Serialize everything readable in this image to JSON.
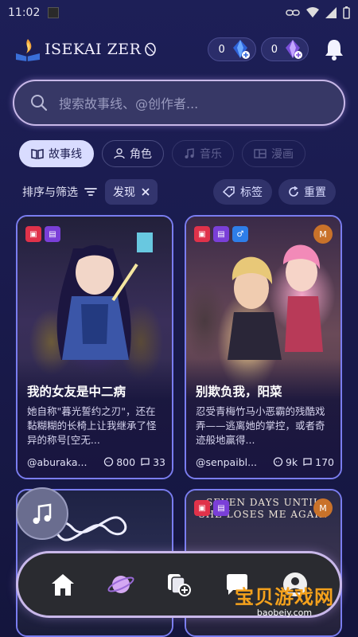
{
  "status_bar": {
    "time": "11:02"
  },
  "app": {
    "title": "ISEKAI ZER"
  },
  "currency": [
    {
      "amount": "0",
      "icon": "blue-gem-icon"
    },
    {
      "amount": "0",
      "icon": "purple-gem-icon"
    }
  ],
  "search": {
    "placeholder": "搜索故事线、@创作者..."
  },
  "chips": [
    {
      "label": "故事线",
      "icon": "book-icon",
      "active": true
    },
    {
      "label": "角色",
      "icon": "person-icon",
      "active": false
    },
    {
      "label": "音乐",
      "icon": "music-note-icon",
      "active": false
    },
    {
      "label": "漫画",
      "icon": "comic-icon",
      "active": false
    }
  ],
  "filter": {
    "sort_label": "排序与筛选",
    "active_tag": "发现",
    "tags_label": "标签",
    "reset_label": "重置"
  },
  "cards": [
    {
      "title": "我的女友是中二病",
      "description": "她自称\"暮光誓约之刃\"，还在黏糊糊的长椅上让我继承了怪异的称号[空无...",
      "author": "@aburaka...",
      "comments": "800",
      "chats": "33",
      "badges": [
        "red",
        "purple"
      ]
    },
    {
      "title": "别欺负我，阳菜",
      "description": "忍受青梅竹马小恶霸的残酷戏弄——逃离她的掌控，或者奇迹般地赢得...",
      "author": "@senpaibl...",
      "comments": "9k",
      "chats": "170",
      "badges": [
        "red",
        "purple",
        "blue"
      ],
      "corner": "M"
    },
    {
      "badges": []
    },
    {
      "badges": [
        "red",
        "purple"
      ],
      "corner": "M",
      "art_title": "SEVEN DAYS UNTIL SHE LOSES ME AGAIN"
    }
  ],
  "bottom_nav": [
    "home-icon",
    "planet-icon",
    "create-icon",
    "chat-icon",
    "profile-icon"
  ],
  "watermark": {
    "cn": "宝贝游戏网",
    "url": "baobeiy.com"
  },
  "colors": {
    "accent": "#7a7df0",
    "chip_active": "#d9dcff",
    "background": "#1d1f57",
    "badge_red": "#e0324a",
    "badge_purple": "#7a3fd8",
    "badge_blue": "#2e7ee8",
    "badge_m": "#c9722a"
  }
}
